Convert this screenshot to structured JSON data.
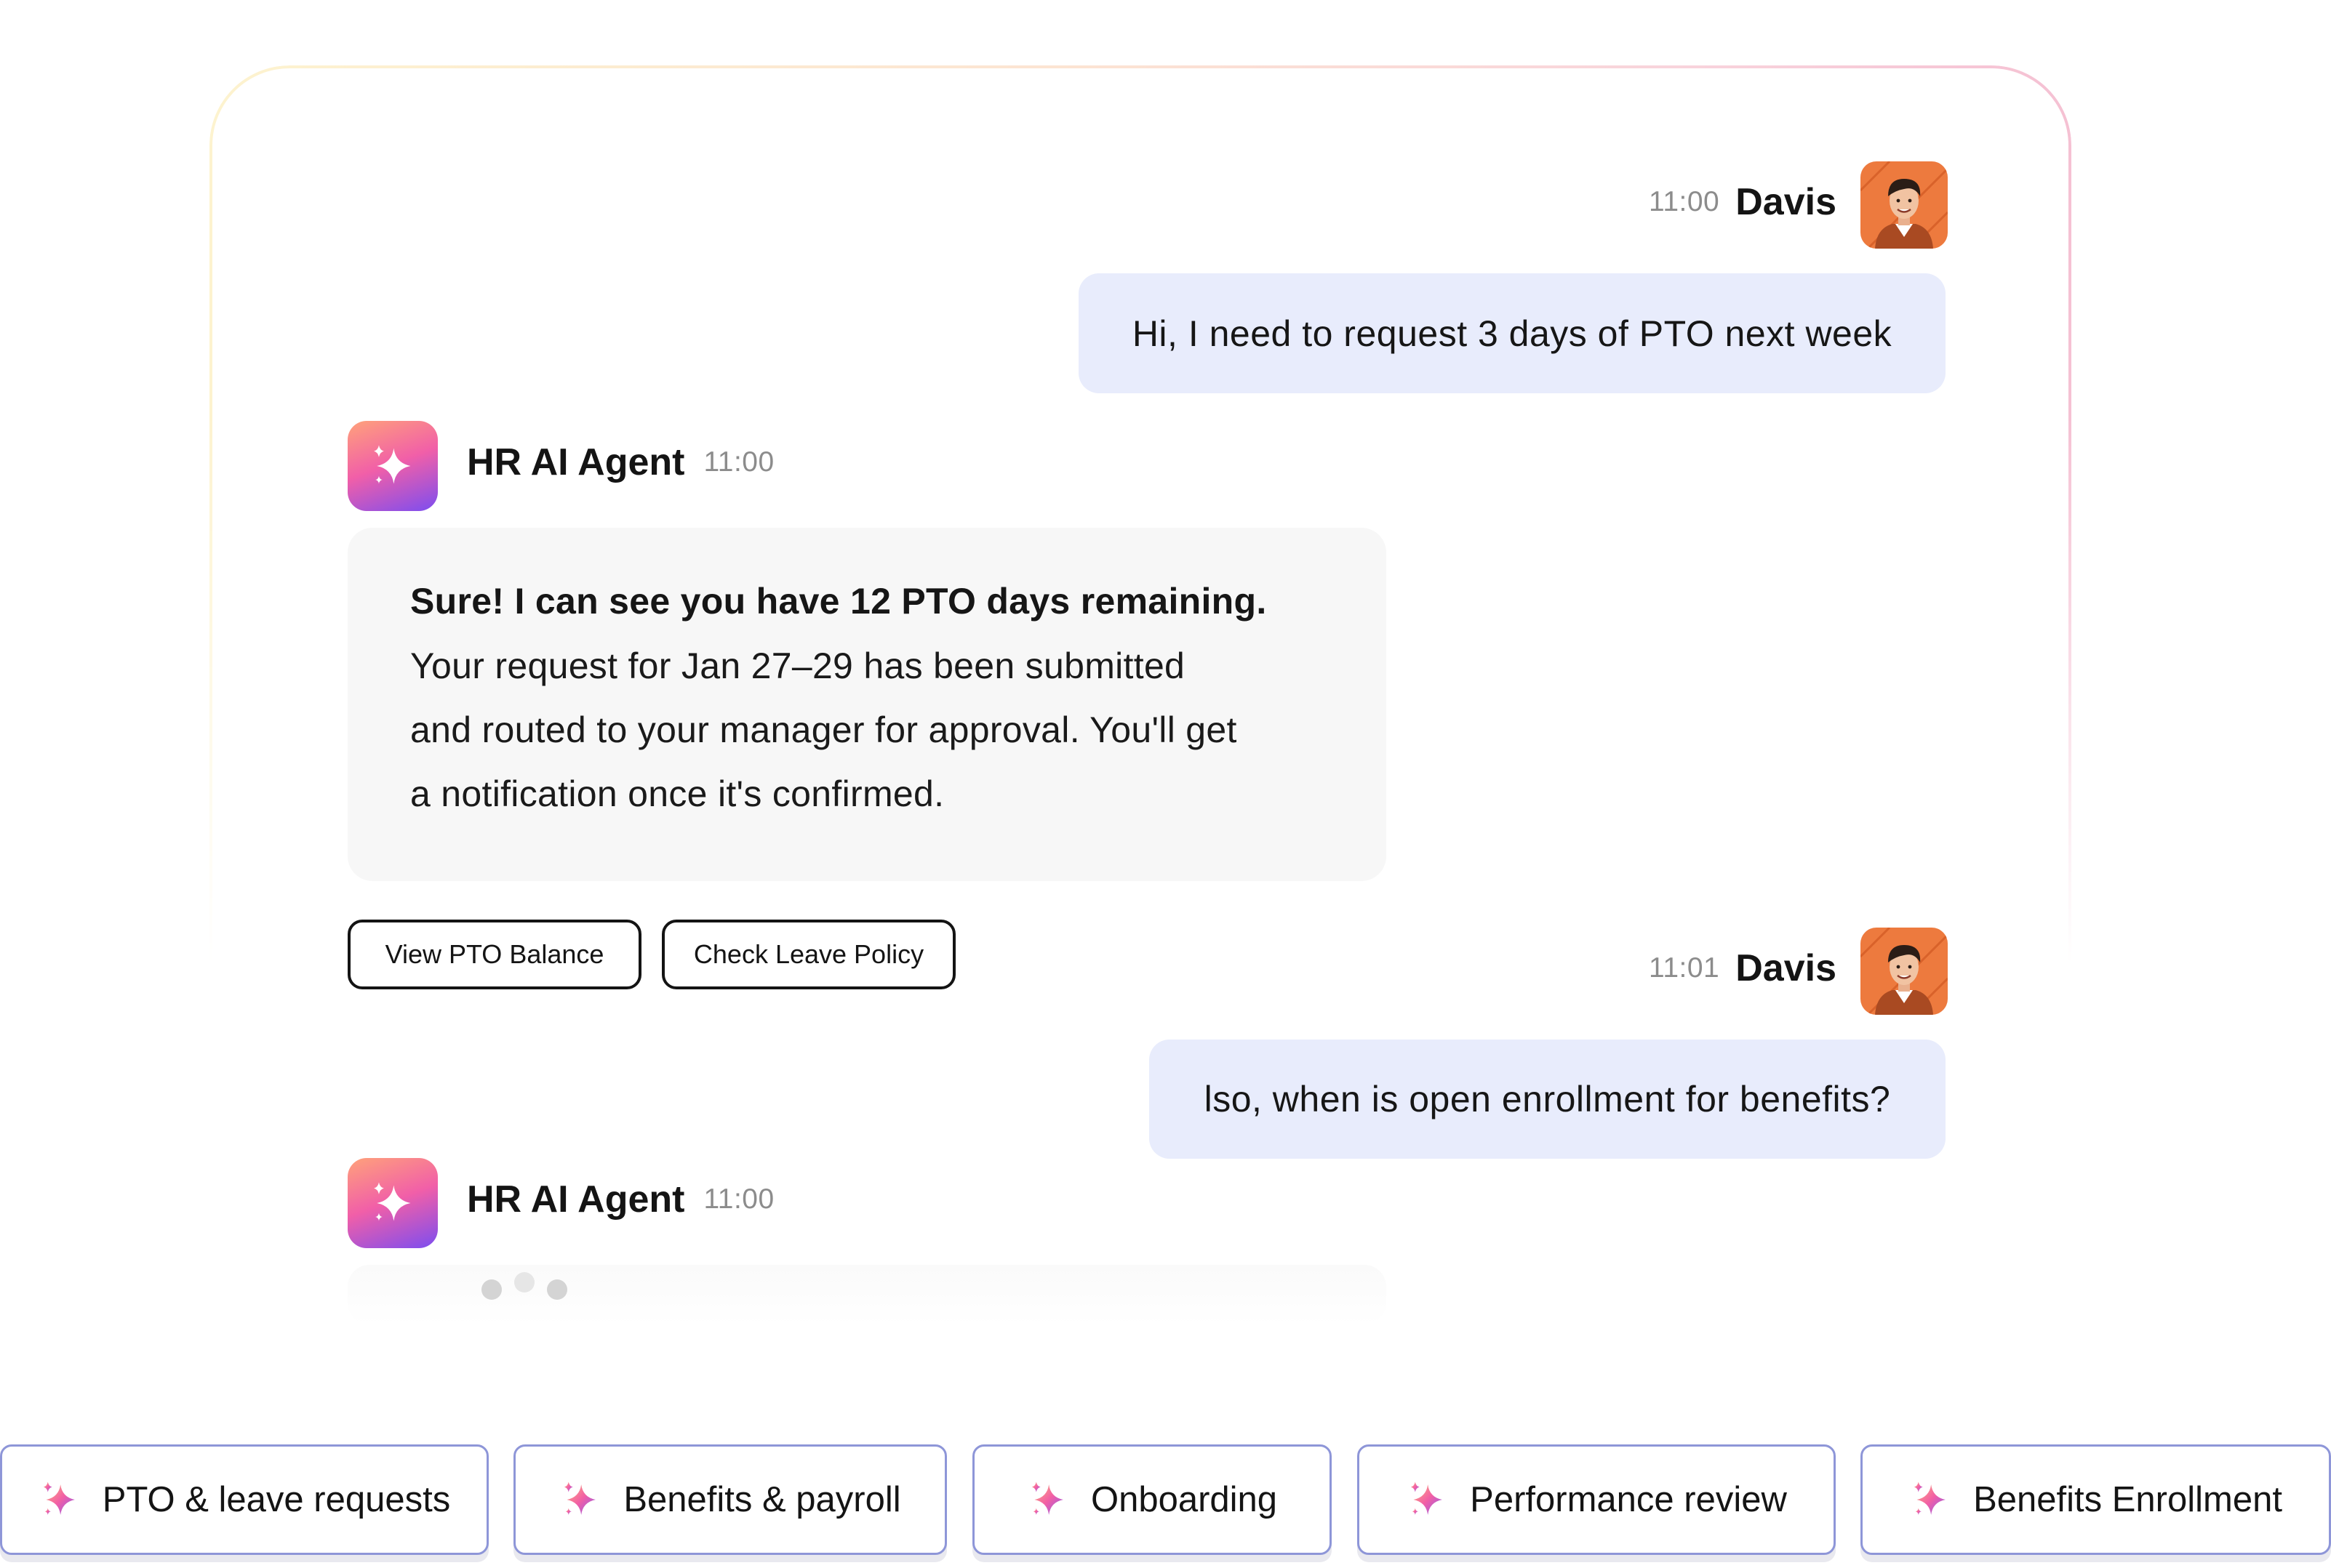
{
  "conversation": {
    "messages": [
      {
        "sender": "Davis",
        "time": "11:00",
        "text": "Hi, I need to request 3 days of PTO next week"
      },
      {
        "sender": "HR AI Agent",
        "time": "11:00",
        "headline": "Sure! I can see you have 12 PTO days remaining.",
        "lines": [
          "Your request for Jan 27–29 has been submitted",
          "and routed to your manager for approval. You'll get",
          "a notification once it's confirmed."
        ],
        "actions": [
          "View PTO Balance",
          "Check Leave Policy"
        ]
      },
      {
        "sender": "Davis",
        "time": "11:01",
        "text": "lso, when is open enrollment for benefits?"
      },
      {
        "sender": "HR AI Agent",
        "time": "11:00",
        "typing": true
      }
    ]
  },
  "suggestions": [
    "PTO & leave requests",
    "Benefits & payroll",
    "Onboarding",
    "Performance review",
    "Benefits Enrollment"
  ],
  "icons": {
    "agent": "sparkles-icon",
    "suggestion": "sparkle-icon",
    "user_avatar": "user-photo-avatar"
  },
  "colors": {
    "user_bubble": "#e8ecfc",
    "agent_bubble": "#f7f7f7",
    "chip_border": "#8e96d8",
    "agent_icon_gradient": [
      "#ffa27a",
      "#f15fa8",
      "#7c4df0"
    ]
  }
}
